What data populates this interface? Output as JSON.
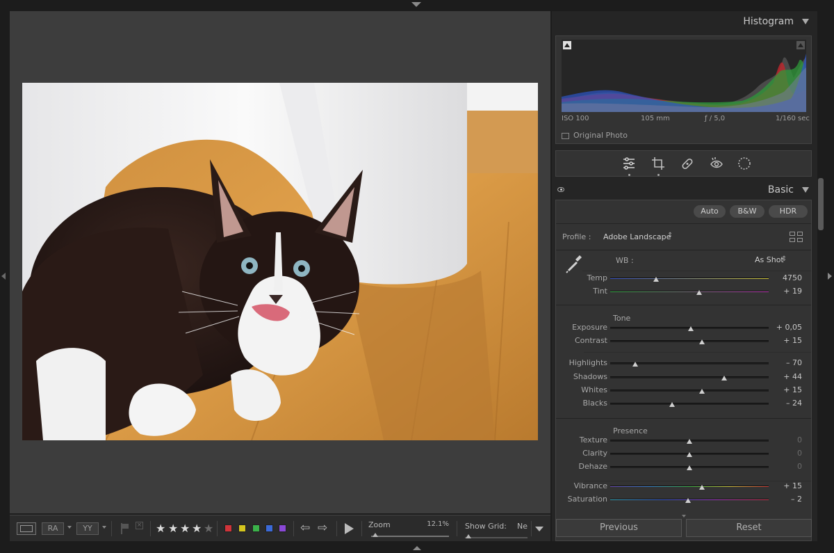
{
  "histogram": {
    "title": "Histogram",
    "iso": "ISO 100",
    "focal": "105 mm",
    "aperture": "ƒ / 5,0",
    "shutter": "1/160 sec",
    "original_photo": "Original Photo"
  },
  "basic": {
    "title": "Basic",
    "auto": "Auto",
    "bw": "B&W",
    "hdr": "HDR",
    "profile_label": "Profile :",
    "profile_value": "Adobe Landscape",
    "wb_label": "WB :",
    "wb_value": "As Shot",
    "tone_label": "Tone",
    "presence_label": "Presence",
    "sliders": [
      {
        "label": "Temp",
        "value": "4750",
        "pos": 0.29
      },
      {
        "label": "Tint",
        "value": "+ 19",
        "pos": 0.56
      },
      {
        "label": "Exposure",
        "value": "+ 0,05",
        "pos": 0.51
      },
      {
        "label": "Contrast",
        "value": "+ 15",
        "pos": 0.58
      },
      {
        "label": "Highlights",
        "value": "– 70",
        "pos": 0.16
      },
      {
        "label": "Shadows",
        "value": "+ 44",
        "pos": 0.72
      },
      {
        "label": "Whites",
        "value": "+ 15",
        "pos": 0.58
      },
      {
        "label": "Blacks",
        "value": "– 24",
        "pos": 0.39
      },
      {
        "label": "Texture",
        "value": "0",
        "pos": 0.5
      },
      {
        "label": "Clarity",
        "value": "0",
        "pos": 0.5
      },
      {
        "label": "Dehaze",
        "value": "0",
        "pos": 0.5
      },
      {
        "label": "Vibrance",
        "value": "+ 15",
        "pos": 0.58
      },
      {
        "label": "Saturation",
        "value": "– 2",
        "pos": 0.49
      }
    ]
  },
  "toolbar": {
    "zoom_label": "Zoom",
    "zoom_value": "12.1%",
    "show_grid_label": "Show Grid:",
    "show_grid_value": "Ne",
    "rating": 4
  },
  "buttons": {
    "previous": "Previous",
    "reset": "Reset"
  },
  "colors": {
    "red": "#d0343a",
    "yellow": "#d4c51e",
    "green": "#3bb24a",
    "blue": "#3b6ad8",
    "purple": "#8a48d6"
  }
}
